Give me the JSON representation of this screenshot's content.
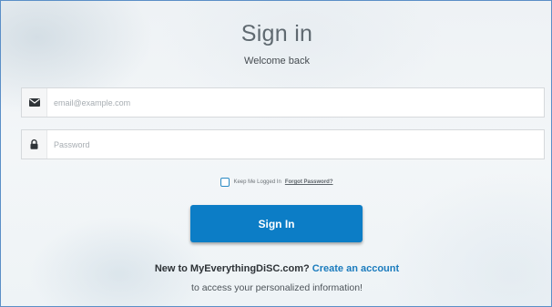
{
  "form": {
    "title": "Sign in",
    "subtitle": "Welcome back",
    "email": {
      "placeholder": "email@example.com",
      "value": "",
      "icon": "envelope-icon"
    },
    "password": {
      "placeholder": "Password",
      "value": "",
      "icon": "lock-icon"
    },
    "remember_label": "Keep Me Logged In",
    "forgot_link": "Forgot Password?",
    "signin_label": "Sign In",
    "new_text": "New to MyEverythingDiSC.com?",
    "create_link": "Create an account",
    "access_text": "to access your personalized information!"
  },
  "colors": {
    "accent": "#0c7dc6",
    "link": "#1a7bbd",
    "frame_border": "#5b8fc7"
  }
}
